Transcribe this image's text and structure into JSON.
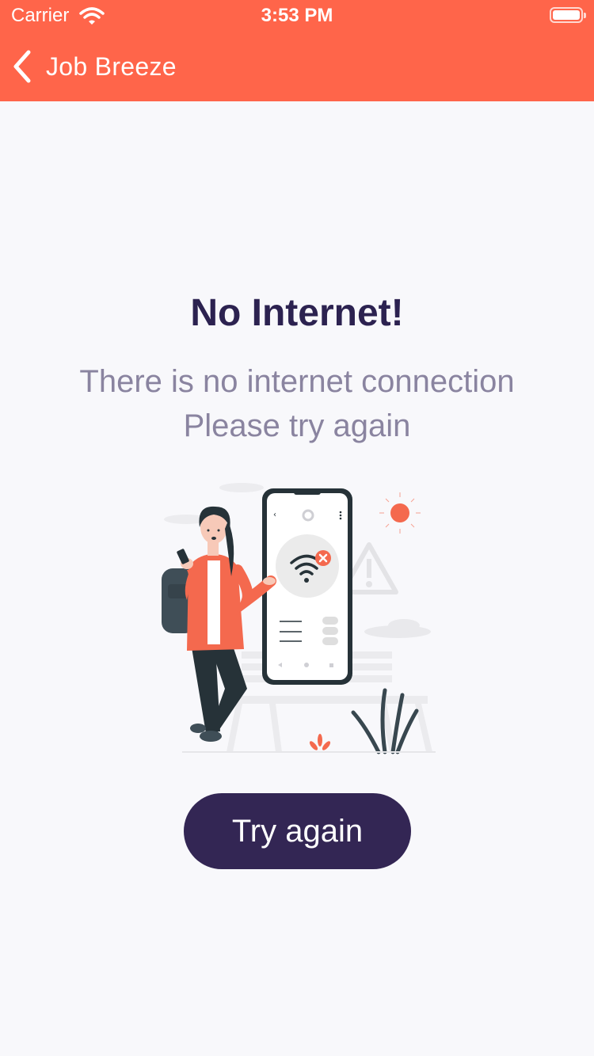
{
  "status_bar": {
    "carrier": "Carrier",
    "time": "3:53 PM"
  },
  "nav": {
    "title": "Job Breeze",
    "back_icon": "chevron-left-icon"
  },
  "main": {
    "title": "No Internet!",
    "subtitle_line1": "There is no internet connection",
    "subtitle_line2": "Please try again",
    "illustration": "no-internet-illustration",
    "button_label": "Try again"
  },
  "colors": {
    "header": "#ff654a",
    "background": "#f8f8fb",
    "title": "#2c2250",
    "subtitle": "#8a84a0",
    "button": "#332654",
    "accent": "#f4694e"
  }
}
